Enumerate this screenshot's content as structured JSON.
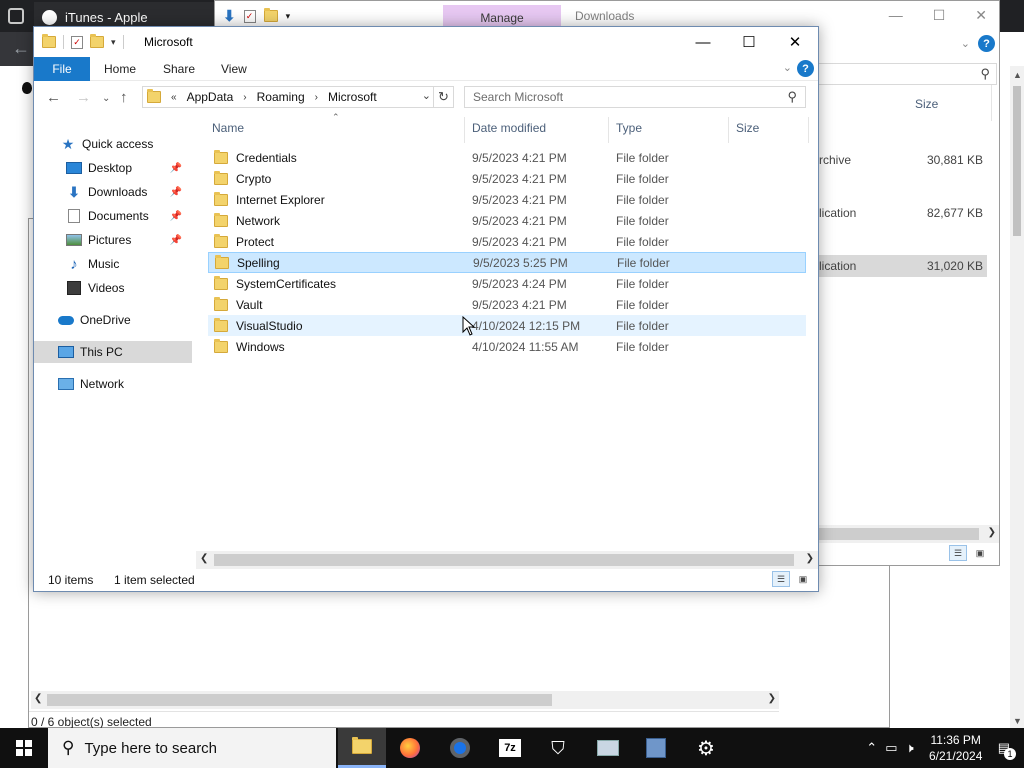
{
  "browser": {
    "tab_title": "iTunes - Apple"
  },
  "downloads_window": {
    "manage_tab": "Manage",
    "title": "Downloads",
    "size_header": "Size",
    "rows": [
      {
        "type": "rchive",
        "size": "30,881 KB"
      },
      {
        "type": "lication",
        "size": "82,677 KB"
      },
      {
        "type": "lication",
        "size": "31,020 KB"
      }
    ]
  },
  "sevenzip_window": {
    "status": "0 / 6 object(s) selected"
  },
  "explorer": {
    "title": "Microsoft",
    "ribbon_tabs": [
      "File",
      "Home",
      "Share",
      "View"
    ],
    "help_label": "?",
    "address": {
      "overflow": "«",
      "segments": [
        "AppData",
        "Roaming",
        "Microsoft"
      ]
    },
    "search_placeholder": "Search Microsoft",
    "columns": [
      "Name",
      "Date modified",
      "Type",
      "Size"
    ],
    "files": [
      {
        "name": "Credentials",
        "date": "9/5/2023 4:21 PM",
        "type": "File folder"
      },
      {
        "name": "Crypto",
        "date": "9/5/2023 4:21 PM",
        "type": "File folder"
      },
      {
        "name": "Internet Explorer",
        "date": "9/5/2023 4:21 PM",
        "type": "File folder"
      },
      {
        "name": "Network",
        "date": "9/5/2023 4:21 PM",
        "type": "File folder"
      },
      {
        "name": "Protect",
        "date": "9/5/2023 4:21 PM",
        "type": "File folder"
      },
      {
        "name": "Spelling",
        "date": "9/5/2023 5:25 PM",
        "type": "File folder"
      },
      {
        "name": "SystemCertificates",
        "date": "9/5/2023 4:24 PM",
        "type": "File folder"
      },
      {
        "name": "Vault",
        "date": "9/5/2023 4:21 PM",
        "type": "File folder"
      },
      {
        "name": "VisualStudio",
        "date": "4/10/2024 12:15 PM",
        "type": "File folder"
      },
      {
        "name": "Windows",
        "date": "4/10/2024 11:55 AM",
        "type": "File folder"
      }
    ],
    "nav": {
      "quick_access": "Quick access",
      "desktop": "Desktop",
      "downloads": "Downloads",
      "documents": "Documents",
      "pictures": "Pictures",
      "music": "Music",
      "videos": "Videos",
      "onedrive": "OneDrive",
      "this_pc": "This PC",
      "network": "Network"
    },
    "status_count": "10 items",
    "status_selected": "1 item selected"
  },
  "taskbar": {
    "search_placeholder": "Type here to search",
    "time": "11:36 PM",
    "date": "6/21/2024",
    "notification_count": "1",
    "apps": [
      "file-explorer",
      "firefox",
      "chrome",
      "7zip",
      "security",
      "app-6",
      "app-7",
      "settings"
    ]
  },
  "colors": {
    "ribbon_file": "#1979ca",
    "selection": "#cce8ff",
    "manage_tab": "#e7c8f2",
    "taskbar": "#101010"
  }
}
